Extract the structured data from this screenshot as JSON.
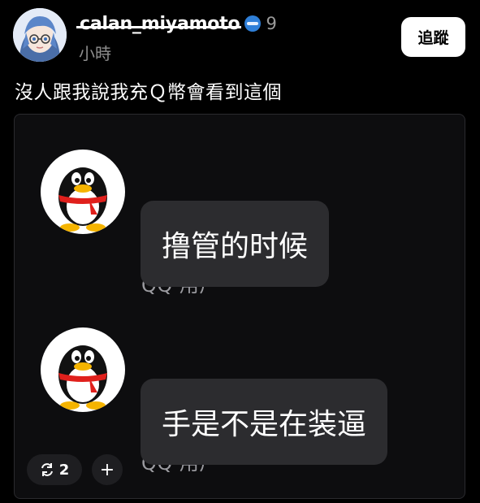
{
  "post": {
    "username": "calan_miyamoto",
    "follower_count": "9",
    "timestamp": "小時",
    "follow_label": "追蹤",
    "caption": "沒人跟我說我充Ｑ幣會看到這個"
  },
  "chat": {
    "messages": [
      {
        "sender": "QQ 用户",
        "text": "撸管的时候"
      },
      {
        "sender": "QQ 用户",
        "text": "手是不是在装逼"
      }
    ]
  },
  "actions": {
    "repost_count": "2",
    "add_label": "+"
  },
  "colors": {
    "background": "#000000",
    "card": "#0d0d0f",
    "bubble": "#2c2c2f",
    "muted_text": "#8e8e8e",
    "verified": "#2f7fd8"
  },
  "icons": [
    "avatar-anime",
    "verified-icon",
    "qq-penguin-icon",
    "repost-icon",
    "plus-icon"
  ]
}
